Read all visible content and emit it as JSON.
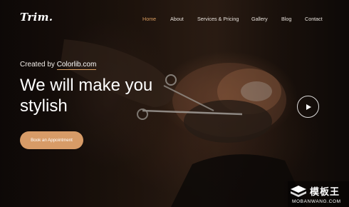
{
  "header": {
    "logo": "Trim.",
    "nav": [
      {
        "label": "Home",
        "active": true
      },
      {
        "label": "About",
        "active": false
      },
      {
        "label": "Services & Pricing",
        "active": false
      },
      {
        "label": "Gallery",
        "active": false
      },
      {
        "label": "Blog",
        "active": false
      },
      {
        "label": "Contact",
        "active": false
      }
    ]
  },
  "hero": {
    "created_prefix": "Created by",
    "created_brand": "Colorlib.com",
    "headline_line1": "We will make you",
    "headline_line2": "stylish",
    "cta_label": "Book an Appointment",
    "play_icon": "play-icon"
  },
  "watermark": {
    "cn_text": "模板王",
    "url_text": "MOBANWANG.COM"
  },
  "colors": {
    "accent": "#d79b5f",
    "button": "#d79b67",
    "text": "#ffffff"
  }
}
